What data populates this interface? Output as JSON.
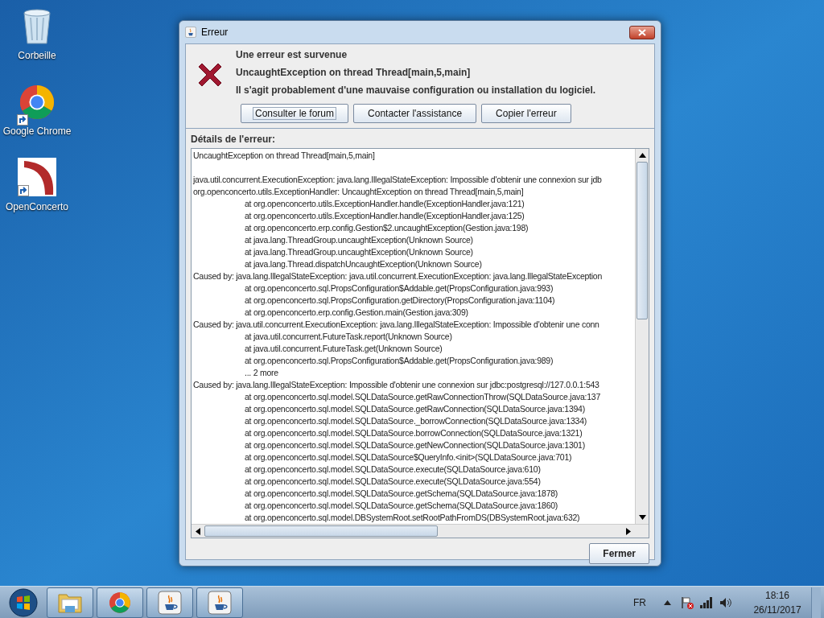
{
  "desktop_icons": [
    {
      "label": "Corbeille",
      "kind": "bin"
    },
    {
      "label": "Google Chrome",
      "kind": "chrome"
    },
    {
      "label": "OpenConcerto",
      "kind": "app"
    }
  ],
  "dialog": {
    "title": "Erreur",
    "heading": "Une erreur est survenue",
    "exception": "UncaughtException on thread Thread[main,5,main]",
    "message": "Il s'agit probablement d'une mauvaise configuration ou installation du logiciel.",
    "buttons": [
      {
        "label": "Consulter le forum",
        "focused": true
      },
      {
        "label": "Contacter l'assistance",
        "focused": false
      },
      {
        "label": "Copier l'erreur",
        "focused": false
      }
    ],
    "details_label": "Détails de l'erreur:",
    "details_lines": [
      {
        "kind": "head",
        "text": "UncaughtException on thread Thread[main,5,main]"
      },
      {
        "kind": "blank"
      },
      {
        "kind": "head",
        "text": "java.util.concurrent.ExecutionException: java.lang.IllegalStateException: Impossible d'obtenir une connexion sur jdb"
      },
      {
        "kind": "head",
        "text": "org.openconcerto.utils.ExceptionHandler: UncaughtException on thread Thread[main,5,main]"
      },
      {
        "kind": "frame",
        "text": "at org.openconcerto.utils.ExceptionHandler.handle(ExceptionHandler.java:121)"
      },
      {
        "kind": "frame",
        "text": "at org.openconcerto.utils.ExceptionHandler.handle(ExceptionHandler.java:125)"
      },
      {
        "kind": "frame",
        "text": "at org.openconcerto.erp.config.Gestion$2.uncaughtException(Gestion.java:198)"
      },
      {
        "kind": "frame",
        "text": "at java.lang.ThreadGroup.uncaughtException(Unknown Source)"
      },
      {
        "kind": "frame",
        "text": "at java.lang.ThreadGroup.uncaughtException(Unknown Source)"
      },
      {
        "kind": "frame",
        "text": "at java.lang.Thread.dispatchUncaughtException(Unknown Source)"
      },
      {
        "kind": "head",
        "text": "Caused by: java.lang.IllegalStateException: java.util.concurrent.ExecutionException: java.lang.IllegalStateException"
      },
      {
        "kind": "frame",
        "text": "at org.openconcerto.sql.PropsConfiguration$Addable.get(PropsConfiguration.java:993)"
      },
      {
        "kind": "frame",
        "text": "at org.openconcerto.sql.PropsConfiguration.getDirectory(PropsConfiguration.java:1104)"
      },
      {
        "kind": "frame",
        "text": "at org.openconcerto.erp.config.Gestion.main(Gestion.java:309)"
      },
      {
        "kind": "head",
        "text": "Caused by: java.util.concurrent.ExecutionException: java.lang.IllegalStateException: Impossible d'obtenir une conn"
      },
      {
        "kind": "frame",
        "text": "at java.util.concurrent.FutureTask.report(Unknown Source)"
      },
      {
        "kind": "frame",
        "text": "at java.util.concurrent.FutureTask.get(Unknown Source)"
      },
      {
        "kind": "frame",
        "text": "at org.openconcerto.sql.PropsConfiguration$Addable.get(PropsConfiguration.java:989)"
      },
      {
        "kind": "frame",
        "text": "... 2 more"
      },
      {
        "kind": "head",
        "text": "Caused by: java.lang.IllegalStateException: Impossible d'obtenir une connexion sur jdbc:postgresql://127.0.0.1:543"
      },
      {
        "kind": "frame",
        "text": "at org.openconcerto.sql.model.SQLDataSource.getRawConnectionThrow(SQLDataSource.java:137"
      },
      {
        "kind": "frame",
        "text": "at org.openconcerto.sql.model.SQLDataSource.getRawConnection(SQLDataSource.java:1394)"
      },
      {
        "kind": "frame",
        "text": "at org.openconcerto.sql.model.SQLDataSource._borrowConnection(SQLDataSource.java:1334)"
      },
      {
        "kind": "frame",
        "text": "at org.openconcerto.sql.model.SQLDataSource.borrowConnection(SQLDataSource.java:1321)"
      },
      {
        "kind": "frame",
        "text": "at org.openconcerto.sql.model.SQLDataSource.getNewConnection(SQLDataSource.java:1301)"
      },
      {
        "kind": "frame",
        "text": "at org.openconcerto.sql.model.SQLDataSource$QueryInfo.<init>(SQLDataSource.java:701)"
      },
      {
        "kind": "frame",
        "text": "at org.openconcerto.sql.model.SQLDataSource.execute(SQLDataSource.java:610)"
      },
      {
        "kind": "frame",
        "text": "at org.openconcerto.sql.model.SQLDataSource.execute(SQLDataSource.java:554)"
      },
      {
        "kind": "frame",
        "text": "at org.openconcerto.sql.model.SQLDataSource.getSchema(SQLDataSource.java:1878)"
      },
      {
        "kind": "frame",
        "text": "at org.openconcerto.sql.model.SQLDataSource.getSchema(SQLDataSource.java:1860)"
      },
      {
        "kind": "frame",
        "text": "at org.openconcerto.sql.model.DBSystemRoot.setRootPathFromDS(DBSystemRoot.java:632)"
      }
    ],
    "close_label": "Fermer"
  },
  "taskbar": {
    "apps": [
      {
        "kind": "explorer"
      },
      {
        "kind": "chrome"
      },
      {
        "kind": "java"
      },
      {
        "kind": "java"
      }
    ],
    "language": "FR",
    "time": "18:16",
    "date": "26/11/2017"
  }
}
